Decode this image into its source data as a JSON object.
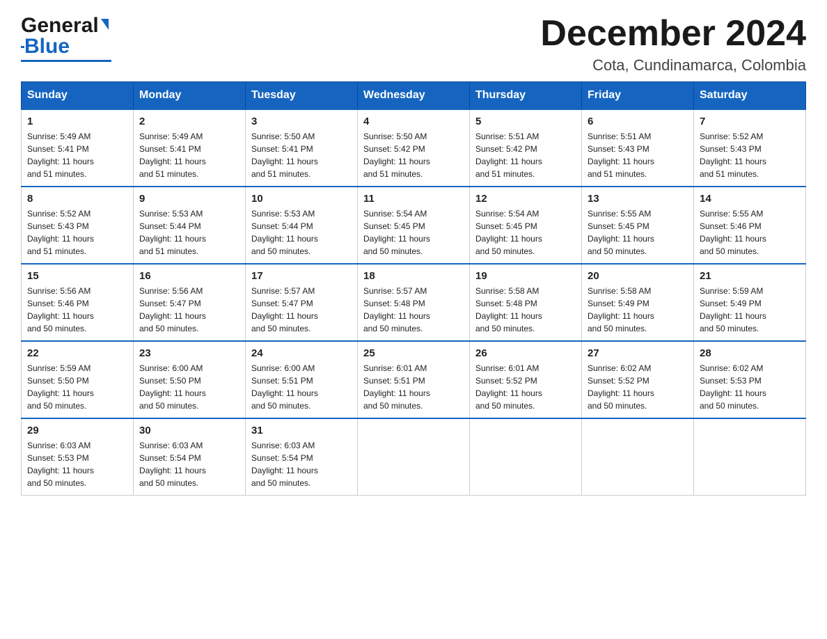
{
  "logo": {
    "text_general": "General",
    "text_blue": "Blue",
    "tagline": ""
  },
  "title": "December 2024",
  "subtitle": "Cota, Cundinamarca, Colombia",
  "headers": [
    "Sunday",
    "Monday",
    "Tuesday",
    "Wednesday",
    "Thursday",
    "Friday",
    "Saturday"
  ],
  "weeks": [
    [
      {
        "day": "1",
        "info": "Sunrise: 5:49 AM\nSunset: 5:41 PM\nDaylight: 11 hours\nand 51 minutes."
      },
      {
        "day": "2",
        "info": "Sunrise: 5:49 AM\nSunset: 5:41 PM\nDaylight: 11 hours\nand 51 minutes."
      },
      {
        "day": "3",
        "info": "Sunrise: 5:50 AM\nSunset: 5:41 PM\nDaylight: 11 hours\nand 51 minutes."
      },
      {
        "day": "4",
        "info": "Sunrise: 5:50 AM\nSunset: 5:42 PM\nDaylight: 11 hours\nand 51 minutes."
      },
      {
        "day": "5",
        "info": "Sunrise: 5:51 AM\nSunset: 5:42 PM\nDaylight: 11 hours\nand 51 minutes."
      },
      {
        "day": "6",
        "info": "Sunrise: 5:51 AM\nSunset: 5:43 PM\nDaylight: 11 hours\nand 51 minutes."
      },
      {
        "day": "7",
        "info": "Sunrise: 5:52 AM\nSunset: 5:43 PM\nDaylight: 11 hours\nand 51 minutes."
      }
    ],
    [
      {
        "day": "8",
        "info": "Sunrise: 5:52 AM\nSunset: 5:43 PM\nDaylight: 11 hours\nand 51 minutes."
      },
      {
        "day": "9",
        "info": "Sunrise: 5:53 AM\nSunset: 5:44 PM\nDaylight: 11 hours\nand 51 minutes."
      },
      {
        "day": "10",
        "info": "Sunrise: 5:53 AM\nSunset: 5:44 PM\nDaylight: 11 hours\nand 50 minutes."
      },
      {
        "day": "11",
        "info": "Sunrise: 5:54 AM\nSunset: 5:45 PM\nDaylight: 11 hours\nand 50 minutes."
      },
      {
        "day": "12",
        "info": "Sunrise: 5:54 AM\nSunset: 5:45 PM\nDaylight: 11 hours\nand 50 minutes."
      },
      {
        "day": "13",
        "info": "Sunrise: 5:55 AM\nSunset: 5:45 PM\nDaylight: 11 hours\nand 50 minutes."
      },
      {
        "day": "14",
        "info": "Sunrise: 5:55 AM\nSunset: 5:46 PM\nDaylight: 11 hours\nand 50 minutes."
      }
    ],
    [
      {
        "day": "15",
        "info": "Sunrise: 5:56 AM\nSunset: 5:46 PM\nDaylight: 11 hours\nand 50 minutes."
      },
      {
        "day": "16",
        "info": "Sunrise: 5:56 AM\nSunset: 5:47 PM\nDaylight: 11 hours\nand 50 minutes."
      },
      {
        "day": "17",
        "info": "Sunrise: 5:57 AM\nSunset: 5:47 PM\nDaylight: 11 hours\nand 50 minutes."
      },
      {
        "day": "18",
        "info": "Sunrise: 5:57 AM\nSunset: 5:48 PM\nDaylight: 11 hours\nand 50 minutes."
      },
      {
        "day": "19",
        "info": "Sunrise: 5:58 AM\nSunset: 5:48 PM\nDaylight: 11 hours\nand 50 minutes."
      },
      {
        "day": "20",
        "info": "Sunrise: 5:58 AM\nSunset: 5:49 PM\nDaylight: 11 hours\nand 50 minutes."
      },
      {
        "day": "21",
        "info": "Sunrise: 5:59 AM\nSunset: 5:49 PM\nDaylight: 11 hours\nand 50 minutes."
      }
    ],
    [
      {
        "day": "22",
        "info": "Sunrise: 5:59 AM\nSunset: 5:50 PM\nDaylight: 11 hours\nand 50 minutes."
      },
      {
        "day": "23",
        "info": "Sunrise: 6:00 AM\nSunset: 5:50 PM\nDaylight: 11 hours\nand 50 minutes."
      },
      {
        "day": "24",
        "info": "Sunrise: 6:00 AM\nSunset: 5:51 PM\nDaylight: 11 hours\nand 50 minutes."
      },
      {
        "day": "25",
        "info": "Sunrise: 6:01 AM\nSunset: 5:51 PM\nDaylight: 11 hours\nand 50 minutes."
      },
      {
        "day": "26",
        "info": "Sunrise: 6:01 AM\nSunset: 5:52 PM\nDaylight: 11 hours\nand 50 minutes."
      },
      {
        "day": "27",
        "info": "Sunrise: 6:02 AM\nSunset: 5:52 PM\nDaylight: 11 hours\nand 50 minutes."
      },
      {
        "day": "28",
        "info": "Sunrise: 6:02 AM\nSunset: 5:53 PM\nDaylight: 11 hours\nand 50 minutes."
      }
    ],
    [
      {
        "day": "29",
        "info": "Sunrise: 6:03 AM\nSunset: 5:53 PM\nDaylight: 11 hours\nand 50 minutes."
      },
      {
        "day": "30",
        "info": "Sunrise: 6:03 AM\nSunset: 5:54 PM\nDaylight: 11 hours\nand 50 minutes."
      },
      {
        "day": "31",
        "info": "Sunrise: 6:03 AM\nSunset: 5:54 PM\nDaylight: 11 hours\nand 50 minutes."
      },
      null,
      null,
      null,
      null
    ]
  ]
}
